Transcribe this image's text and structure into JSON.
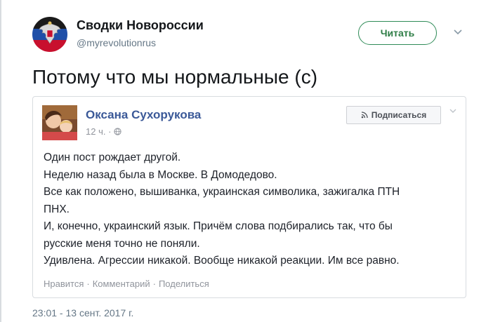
{
  "tweet": {
    "display_name": "Сводки Новороссии",
    "handle": "@myrevolutionrus",
    "follow_label": "Читать",
    "text": "Потому что мы нормальные (с)",
    "timestamp": "23:01 - 13 сент. 2017 г."
  },
  "fb_post": {
    "author": "Оксана Сухорукова",
    "time": "12 ч. ·",
    "subscribe_label": "Подписаться",
    "lines": [
      "Один пост рождает другой.",
      "Неделю назад была в Москве. В Домодедово.",
      "Все как положено, вышиванка, украинская символика, зажигалка ПТН",
      "ПНХ.",
      "И, конечно, украинский язык. Причём слова подбирались так, что бы",
      "русские меня точно не поняли.",
      "Удивлена. Агрессии никакой. Вообще никакой реакции. Им все равно."
    ],
    "actions": {
      "like": "Нравится",
      "comment": "Комментарий",
      "share": "Поделиться",
      "separator": "·"
    }
  },
  "colors": {
    "twitter_name": "#14171a",
    "twitter_secondary": "#657786",
    "follow_accent": "#2e7d46",
    "fb_blue": "#3b5998",
    "fb_gray": "#90949c"
  },
  "icons": {
    "avatar": "coat-of-arms-icon",
    "caret": "chevron-down-icon",
    "globe": "globe-icon",
    "rss": "rss-icon"
  }
}
